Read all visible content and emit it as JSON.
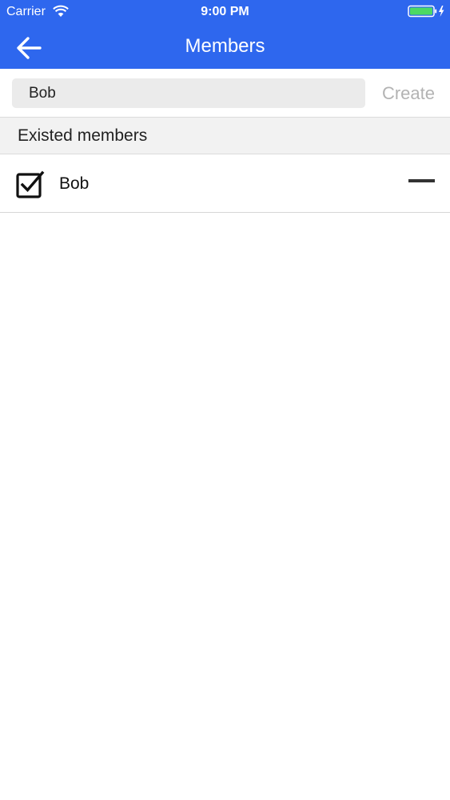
{
  "status_bar": {
    "carrier": "Carrier",
    "time": "9:00 PM",
    "wifi_icon": "wifi-icon",
    "battery_icon": "battery-charging-icon"
  },
  "nav": {
    "title": "Members",
    "back_icon": "arrow-left-icon"
  },
  "create_row": {
    "input_value": "Bob",
    "create_label": "Create"
  },
  "section": {
    "title": "Existed members"
  },
  "members": [
    {
      "name": "Bob",
      "checked": true,
      "checkbox_icon": "checkbox-checked-icon",
      "remove_icon": "minus-icon"
    }
  ],
  "colors": {
    "accent": "#2e67ee",
    "battery_fill": "#4cd964",
    "create_disabled": "#b3b3b3"
  }
}
